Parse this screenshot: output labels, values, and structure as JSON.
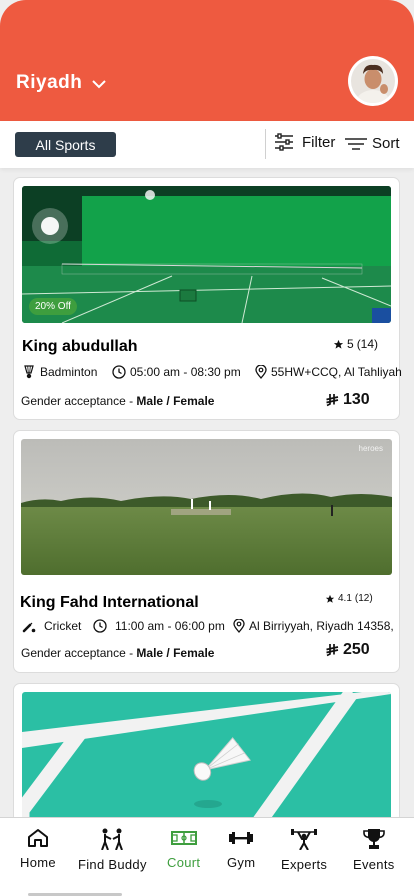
{
  "header": {
    "city": "Riyadh",
    "brand_color": "#ee5a40"
  },
  "filters": {
    "sport_chip": "All Sports",
    "filter_label": "Filter",
    "sort_label": "Sort"
  },
  "venues": [
    {
      "name": "King abudullah",
      "rating": "5",
      "reviews": "(14)",
      "discount": "20% Off",
      "sport": "Badminton",
      "hours": "05:00 am - 08:30 pm",
      "location": "55HW+CCQ, Al Tahliyah",
      "gender_label": "Gender  acceptance -",
      "gender_value": "Male / Female",
      "price": "130",
      "sport_icon": "shuttlecock-icon"
    },
    {
      "name": "King Fahd International",
      "rating": "4.1",
      "reviews": "(12)",
      "sport": "Cricket",
      "hours": "11:00 am - 06:00 pm",
      "location": "Al Birriyyah, Riyadh 14358,",
      "gender_label": "Gender  acceptance -",
      "gender_value": "Male / Female",
      "price": "250",
      "image_watermark": "heroes",
      "sport_icon": "cricket-bat-icon"
    },
    {
      "image_subject": "badminton-court-shuttlecock"
    }
  ],
  "nav": {
    "items": [
      {
        "label": "Home",
        "icon": "home-icon"
      },
      {
        "label": "Find Buddy",
        "icon": "buddy-icon"
      },
      {
        "label": "Court",
        "icon": "court-icon"
      },
      {
        "label": "Gym",
        "icon": "dumbbell-icon"
      },
      {
        "label": "Experts",
        "icon": "weightlifter-icon"
      },
      {
        "label": "Events",
        "icon": "trophy-icon"
      }
    ],
    "active": "Court",
    "active_color": "#3e9e3e"
  }
}
